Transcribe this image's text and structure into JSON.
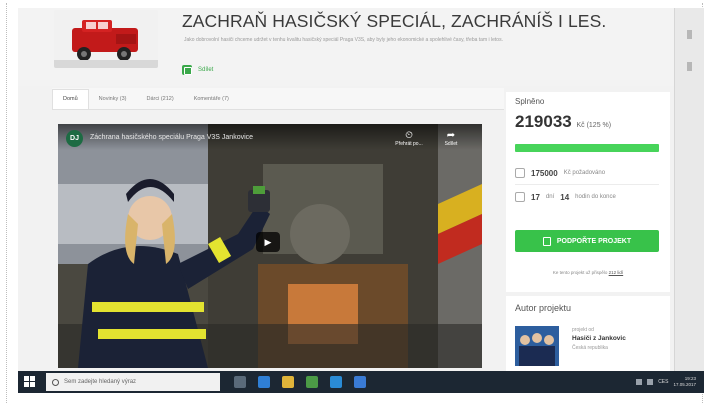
{
  "project": {
    "title": "ZACHRAŇ HASIČSKÝ SPECIÁL, ZACHRÁNÍŠ I LES.",
    "description": "Jako dobrovolní hasiči chceme udržet v tenhu kvalitu hasičský speciál Praga V3S, aby byly jeho ekonomické a spolehlivé časy, třeba tam i letos.",
    "share_label": "Sdílet"
  },
  "tabs": [
    {
      "label": "Domů"
    },
    {
      "label": "Novinky (3)"
    },
    {
      "label": "Dárci (212)"
    },
    {
      "label": "Komentáře (7)"
    }
  ],
  "video": {
    "channel_initials": "DJ",
    "title": "Záchrana hasičského speciálu Praga V3S Jankovice",
    "watch_later_label": "Přehrát po...",
    "share_label": "Sdílet"
  },
  "funding": {
    "fulfilled_label": "Splněno",
    "amount": "219033",
    "amount_suffix": "Kč (125 %)",
    "progress_fraction": 1.0,
    "goal_value": "175000",
    "goal_label": "Kč požadováno",
    "days_value": "17",
    "days_label": "dní",
    "hours_value": "14",
    "hours_label": "hodin do konce",
    "support_button": "PODPOŘTE PROJEKT",
    "note_text": "Ke tento projekt už přispělo",
    "note_link": "212 lidí"
  },
  "author": {
    "heading": "Autor projektu",
    "role": "projekt od",
    "name": "Hasiči z Jankovic",
    "country": "Česká republika"
  },
  "taskbar": {
    "search_placeholder": "Sem zadejte hledaný výraz",
    "tray_lang": "CES",
    "time": "19:23",
    "date": "17.05.2017"
  },
  "colors": {
    "accent_green": "#38c24a",
    "taskbar": "#1c2733"
  }
}
